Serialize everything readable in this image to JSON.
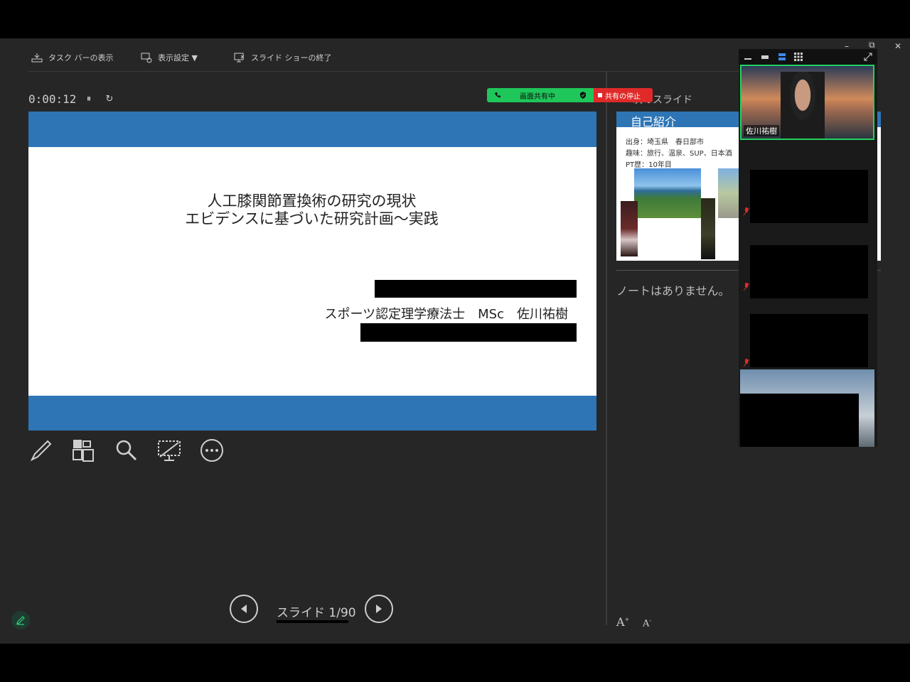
{
  "toolbar": {
    "taskbar_label": "タスク バーの表示",
    "display_settings_label": "表示設定 ▼",
    "end_show_label": "スライド ショーの終了"
  },
  "presenter": {
    "timer": "0:00:12",
    "pause_glyph": "⏸",
    "restart_glyph": "↻"
  },
  "current_slide": {
    "title_line1": "人工膝関節置換術の研究の現状",
    "title_line2": "エビデンスに基づいた研究計画～実践",
    "author": "スポーツ認定理学療法士　MSc　佐川祐樹",
    "accent_color": "#2e75b6"
  },
  "navigation": {
    "slide_label": "スライド 1/90"
  },
  "next_slide": {
    "panel_label": "次のスライド",
    "header": "自己紹介",
    "lines": [
      "出身：埼玉県　春日部市",
      "趣味：旅行、温泉、SUP、日本酒",
      "PT歴：10年目"
    ]
  },
  "notes": {
    "text": "ノートはありません。"
  },
  "font_buttons": {
    "increase": "A",
    "decrease": "A"
  },
  "share": {
    "sharing_label": "画面共有中",
    "stop_label": "共有の停止",
    "green": "#1fc65a",
    "red": "#e02a2a"
  },
  "video": {
    "main_participant": "佐川祐樹"
  }
}
